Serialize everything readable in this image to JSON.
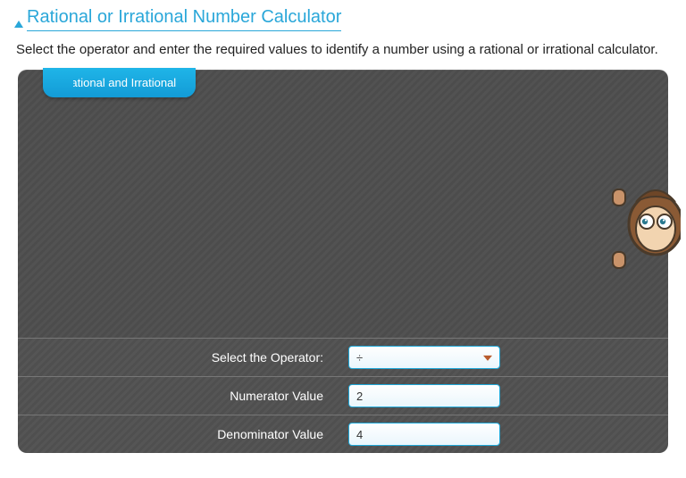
{
  "title": "Rational or Irrational Number Calculator",
  "description": "Select the operator and enter the required values to identify a number using a rational or irrational calculator.",
  "tab_label": "Rational and Irrational",
  "form": {
    "operator_label": "Select the Operator:",
    "operator_value": "÷",
    "numerator_label": "Numerator Value",
    "numerator_value": "2",
    "denominator_label": "Denominator Value",
    "denominator_value": "4"
  }
}
